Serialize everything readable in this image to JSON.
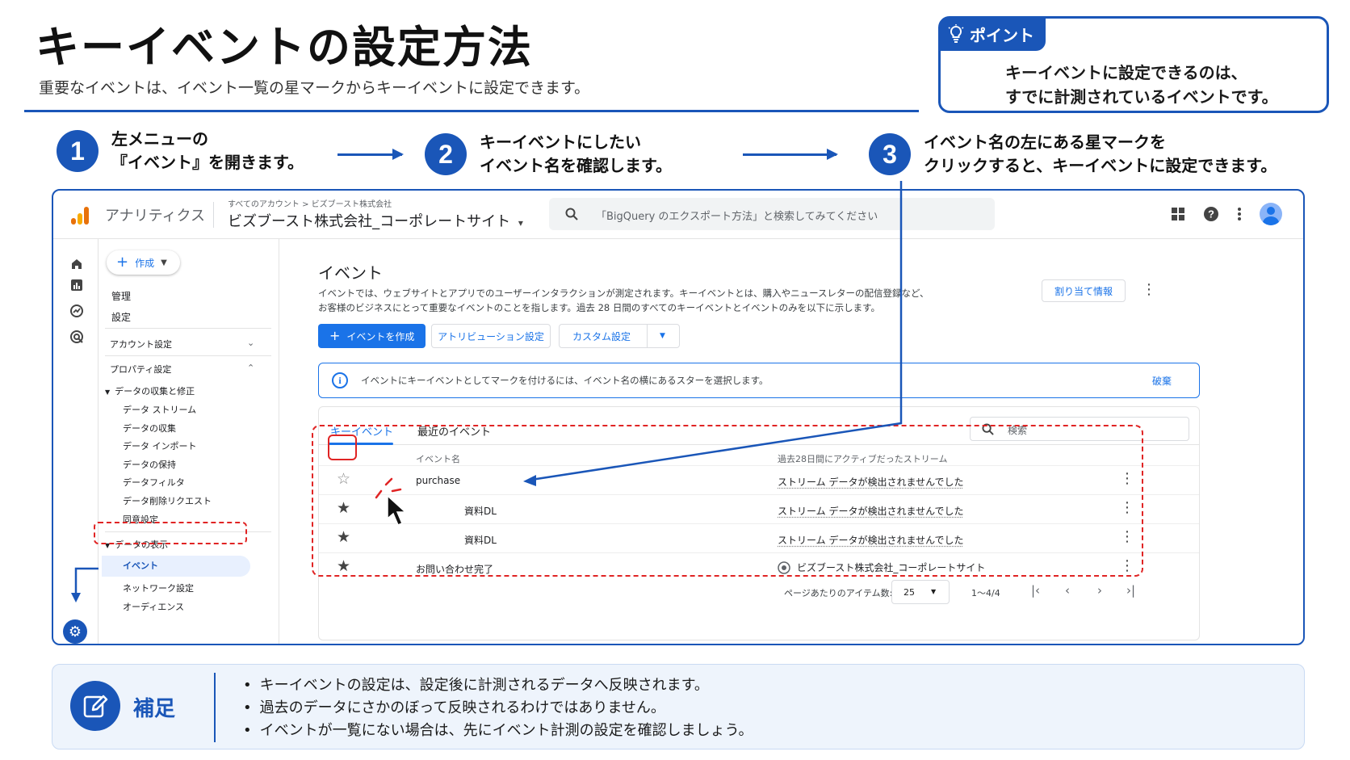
{
  "header": {
    "title": "キーイベントの設定方法",
    "subtitle": "重要なイベントは、イベント一覧の星マークからキーイベントに設定できます。"
  },
  "point": {
    "tag": "ポイント",
    "lines": [
      "キーイベントに設定できるのは、",
      "すでに計測されているイベントです。"
    ]
  },
  "steps": [
    {
      "number": "1",
      "lines": [
        "左メニューの",
        "『イベント』を開きます。"
      ]
    },
    {
      "number": "2",
      "lines": [
        "キーイベントにしたい",
        "イベント名を確認します。"
      ]
    },
    {
      "number": "3",
      "lines": [
        "イベント名の左にある星マークを",
        "クリックすると、キーイベントに設定できます。"
      ]
    }
  ],
  "ga": {
    "app_name": "アナリティクス",
    "breadcrumb": "すべてのアカウント > ビズブースト株式会社",
    "property": "ビズブースト株式会社_コーポレートサイト",
    "search_placeholder": "「BigQuery のエクスポート方法」と検索してみてください",
    "nav": {
      "create": "作成",
      "admin": "管理",
      "settings": "設定",
      "account_settings": "アカウント設定",
      "property_settings": "プロパティ設定",
      "data_collection": "データの収集と修正",
      "data_collection_items": [
        "データ ストリーム",
        "データの収集",
        "データ インポート",
        "データの保持",
        "データフィルタ",
        "データ削除リクエスト",
        "同意設定"
      ],
      "data_display": "データの表示",
      "data_display_items": [
        "イベント",
        "ネットワーク設定",
        "オーディエンス"
      ]
    },
    "content": {
      "title": "イベント",
      "description": [
        "イベントでは、ウェブサイトとアプリでのユーザーインタラクションが測定されます。キーイベントとは、購入やニュースレターの配信登録など、",
        "お客様のビジネスにとって重要なイベントのことを指します。過去 28 日間のすべてのキーイベントとイベントのみを以下に示します。"
      ],
      "assign_info": "割り当て情報",
      "create_event": "イベントを作成",
      "attribution": "アトリビューション設定",
      "custom": "カスタム設定",
      "banner": "イベントにキーイベントとしてマークを付けるには、イベント名の横にあるスターを選択します。",
      "dismiss": "破棄",
      "tabs": [
        "キーイベント",
        "最近のイベント"
      ],
      "table_search": "検索",
      "columns": [
        "イベント名",
        "過去28日間にアクティブだったストリーム"
      ],
      "rows": [
        {
          "name": "purchase",
          "stream": "ストリーム データが検出されませんでした",
          "starred": false
        },
        {
          "name": "資料DL",
          "stream": "ストリーム データが検出されませんでした",
          "starred": true
        },
        {
          "name": "資料DL",
          "stream": "ストリーム データが検出されませんでした",
          "starred": true
        },
        {
          "name": "お問い合わせ完了",
          "stream": "ビズブースト株式会社_コーポレートサイト",
          "starred": true
        }
      ],
      "pager": {
        "label": "ページあたりのアイテム数:",
        "per_page": "25",
        "range": "1～4/4"
      }
    }
  },
  "note": {
    "label": "補足",
    "items": [
      "キーイベントの設定は、設定後に計測されるデータへ反映されます。",
      "過去のデータにさかのぼって反映されるわけではありません。",
      "イベントが一覧にない場合は、先にイベント計測の設定を確認しましょう。"
    ]
  },
  "colors": {
    "brand_blue": "#1a56b8",
    "ga_blue": "#1a73e8",
    "annotation_red": "#e02424"
  }
}
